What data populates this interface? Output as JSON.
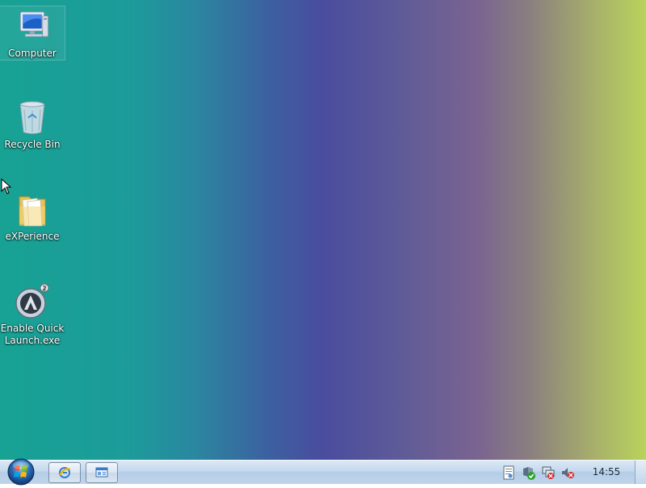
{
  "desktop": {
    "icons": [
      {
        "label": "Computer",
        "icon": "computer-icon"
      },
      {
        "label": "Recycle Bin",
        "icon": "recycle-bin-icon"
      },
      {
        "label": "eXPerience",
        "icon": "folder-icon"
      },
      {
        "label": "Enable Quick Launch.exe",
        "icon": "launch-app-icon"
      }
    ]
  },
  "taskbar": {
    "start": {
      "icon": "windows-start-orb-icon"
    },
    "quick_launch": [
      {
        "icon": "browser-icon"
      },
      {
        "icon": "window-switcher-icon"
      }
    ],
    "tray": [
      {
        "icon": "notes-icon"
      },
      {
        "icon": "security-shield-icon"
      },
      {
        "icon": "network-icon"
      },
      {
        "icon": "volume-muted-icon"
      }
    ],
    "clock": "14:55"
  }
}
